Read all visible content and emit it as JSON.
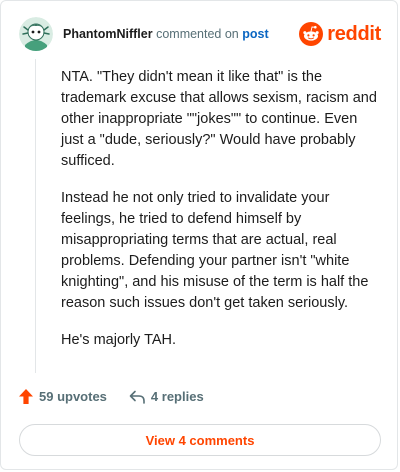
{
  "comment": {
    "username": "PhantomNiffler",
    "action_text": "commented on",
    "link_text": "post",
    "paragraphs": [
      "NTA. \"They didn't mean it like that\" is the trademark excuse that allows sexism, racism and other inappropriate \"\"jokes\"\" to continue. Even just a \"dude, seriously?\" Would have probably sufficed.",
      "Instead he not only tried to invalidate your feelings, he tried to defend himself by misappropriating terms that are actual, real problems. Defending your partner isn't \"white knighting\", and his misuse of the term is half the reason such issues don't get taken seriously.",
      "He's majorly TAH."
    ]
  },
  "brand": {
    "wordmark": "reddit",
    "icon": "reddit-snoo-icon",
    "color": "#ff4500"
  },
  "actions": {
    "upvotes": "59 upvotes",
    "replies": "4 replies",
    "upvote_icon": "upvote-arrow-icon",
    "reply_icon": "reply-arrow-icon",
    "upvote_color": "#ff4500"
  },
  "footer": {
    "view_comments": "View 4 comments"
  }
}
